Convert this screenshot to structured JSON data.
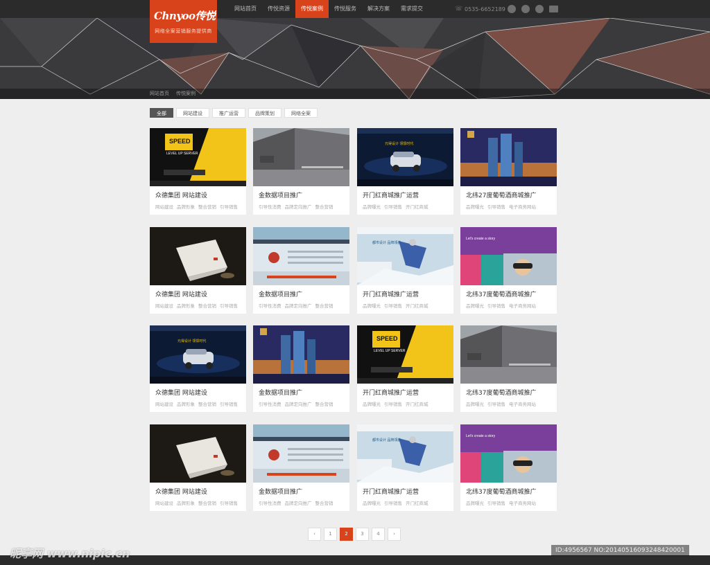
{
  "logo": {
    "brand": "Chnyoo传悦",
    "slogan": "网络全案营销服务提供商"
  },
  "nav": {
    "items": [
      "网站首页",
      "传悦资源",
      "传悦案例",
      "传悦服务",
      "解决方案",
      "需求提交"
    ],
    "active_index": 2
  },
  "contact": {
    "phone": "0535-6652189"
  },
  "social_icons": [
    "qq-icon",
    "weibo-icon",
    "wechat-icon",
    "mail-icon"
  ],
  "breadcrumb": [
    "网站首页",
    "传悦案例"
  ],
  "filters": {
    "items": [
      "全部",
      "网站建设",
      "推广运营",
      "品牌策划",
      "网络全案"
    ],
    "active_index": 0
  },
  "cases": [
    {
      "title": "众德集团 网站建设",
      "tags": [
        "网站建设",
        "品牌形象",
        "整合营销",
        "引导销售"
      ],
      "thumb": "speed"
    },
    {
      "title": "金数据项目推广",
      "tags": [
        "引导性消费",
        "品牌定向推广",
        "整合营销"
      ],
      "thumb": "building"
    },
    {
      "title": "开门红商城推广运营",
      "tags": [
        "品牌曝光",
        "引导销售",
        "开门红商城"
      ],
      "thumb": "car"
    },
    {
      "title": "北纬27度葡萄酒商城推广",
      "tags": [
        "品牌曝光",
        "引导销售",
        "电子商务网站"
      ],
      "thumb": "towers"
    },
    {
      "title": "众德集团 网站建设",
      "tags": [
        "网站建设",
        "品牌形象",
        "整合营销",
        "引导销售"
      ],
      "thumb": "paper"
    },
    {
      "title": "金数据项目推广",
      "tags": [
        "引导性消费",
        "品牌定向推广",
        "整合营销"
      ],
      "thumb": "web"
    },
    {
      "title": "开门红商城推广运营",
      "tags": [
        "品牌曝光",
        "引导销售",
        "开门红商城"
      ],
      "thumb": "snow"
    },
    {
      "title": "北纬37度葡萄酒商城推广",
      "tags": [
        "品牌曝光",
        "引导销售",
        "电子商务网站"
      ],
      "thumb": "purple"
    },
    {
      "title": "众德集团 网站建设",
      "tags": [
        "网站建设",
        "品牌形象",
        "整合营销",
        "引导销售"
      ],
      "thumb": "car"
    },
    {
      "title": "金数据项目推广",
      "tags": [
        "引导性消费",
        "品牌定向推广",
        "整合营销"
      ],
      "thumb": "towers"
    },
    {
      "title": "开门红商城推广运营",
      "tags": [
        "品牌曝光",
        "引导销售",
        "开门红商城"
      ],
      "thumb": "speed"
    },
    {
      "title": "北纬37度葡萄酒商城推广",
      "tags": [
        "品牌曝光",
        "引导销售",
        "电子商务网站"
      ],
      "thumb": "building"
    },
    {
      "title": "众德集团 网站建设",
      "tags": [
        "网站建设",
        "品牌形象",
        "整合营销",
        "引导销售"
      ],
      "thumb": "paper"
    },
    {
      "title": "金数据项目推广",
      "tags": [
        "引导性消费",
        "品牌定向推广",
        "整合营销"
      ],
      "thumb": "web"
    },
    {
      "title": "开门红商城推广运营",
      "tags": [
        "品牌曝光",
        "引导销售",
        "开门红商城"
      ],
      "thumb": "snow"
    },
    {
      "title": "北纬37度葡萄酒商城推广",
      "tags": [
        "品牌曝光",
        "引导销售",
        "电子商务网站"
      ],
      "thumb": "purple"
    }
  ],
  "pagination": {
    "prev": "‹",
    "next": "›",
    "pages": [
      "1",
      "2",
      "3",
      "4"
    ],
    "active_index": 1
  },
  "watermark": {
    "left": "昵享网 www.nipic.cn",
    "right": "ID:4956567 NO:20140516093248420001"
  },
  "colors": {
    "accent": "#d9431c",
    "topbar": "#2b2b2b",
    "page_bg": "#eeeeee"
  }
}
